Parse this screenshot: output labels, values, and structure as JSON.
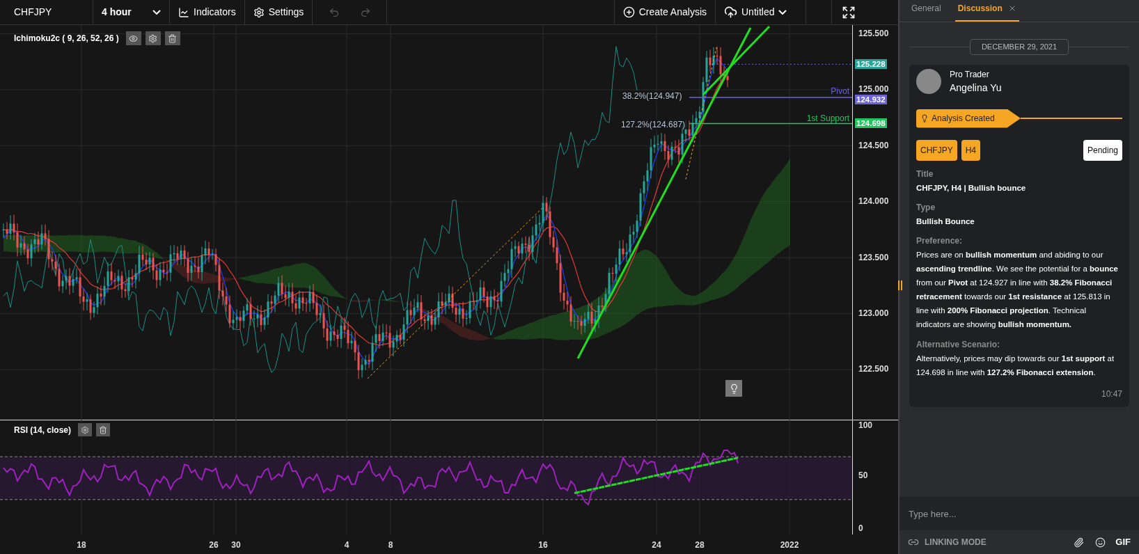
{
  "toolbar": {
    "symbol": "CHFJPY",
    "timeframe": "4 hour",
    "tools": [
      {
        "kind": "indicators",
        "label": "Indicators"
      },
      {
        "kind": "settings",
        "label": "Settings"
      }
    ],
    "history": [
      {
        "kind": "undo",
        "disabled": true
      },
      {
        "kind": "redo",
        "disabled": true
      }
    ],
    "create_label": "Create Analysis",
    "file_name": "Untitled"
  },
  "chart": {
    "indicator": "Ichimoku2c ( 9, 26, 52, 26 )",
    "price_ticks": [
      "125.500",
      "125.000",
      "124.500",
      "124.000",
      "123.500",
      "123.000",
      "122.500"
    ],
    "price_tags": [
      {
        "label": "125.228",
        "color": "#26a69a"
      },
      {
        "label": "124.932",
        "color": "#6c63d6"
      },
      {
        "label": "124.698",
        "color": "#22c55e"
      }
    ],
    "level_lines": [
      {
        "label": "Pivot",
        "color": "#6c63d6"
      },
      {
        "label": "1st Support",
        "color": "#22c55e"
      }
    ],
    "fib_labels": [
      "38.2%(124.947)",
      "127.2%(124.687)"
    ]
  },
  "rsi": {
    "label": "RSI (14, close)",
    "ticks": [
      "100",
      "50",
      "0"
    ]
  },
  "x_axis": [
    "18",
    "26",
    "30",
    "4",
    "8",
    "16",
    "24",
    "28",
    "2022"
  ],
  "panel": {
    "tabs": [
      {
        "label": "General",
        "selected": false,
        "closable": false
      },
      {
        "label": "Discussion",
        "selected": true,
        "closable": true
      }
    ],
    "date": "DECEMBER 29, 2021",
    "author": {
      "role": "Pro Trader",
      "name": "Angelina Yu"
    },
    "banner": "Analysis Created",
    "tags": [
      "CHFJPY",
      "H4"
    ],
    "status": "Pending",
    "fields": [
      {
        "label": "Title",
        "value": "CHFJPY, H4 | Bullish bounce",
        "kind": "strong"
      },
      {
        "label": "Type",
        "value": "Bullish Bounce",
        "kind": "strong"
      },
      {
        "label": "Preference:",
        "value": "Prices are on **bullish momentum** and abiding to our **ascending trendline**. We see the potential for a **bounce** from our **Pivot** at 124.927 in line with **38.2% Fibonacci retracement** towards our **1st resistance** at 125.813 in line with **200% Fibonacci projection**. Technical indicators are showing **bullish momentum.**",
        "kind": "rich"
      },
      {
        "label": "Alternative Scenario:",
        "value": "Alternatively, prices may dip towards our **1st support** at 124.698 in line with **127.2% Fibonacci extension**.",
        "kind": "rich"
      }
    ],
    "time": "10:47",
    "input": {
      "placeholder": "Type here..."
    },
    "footer": {
      "mode": "LINKING MODE",
      "gif": "GIF"
    }
  }
}
